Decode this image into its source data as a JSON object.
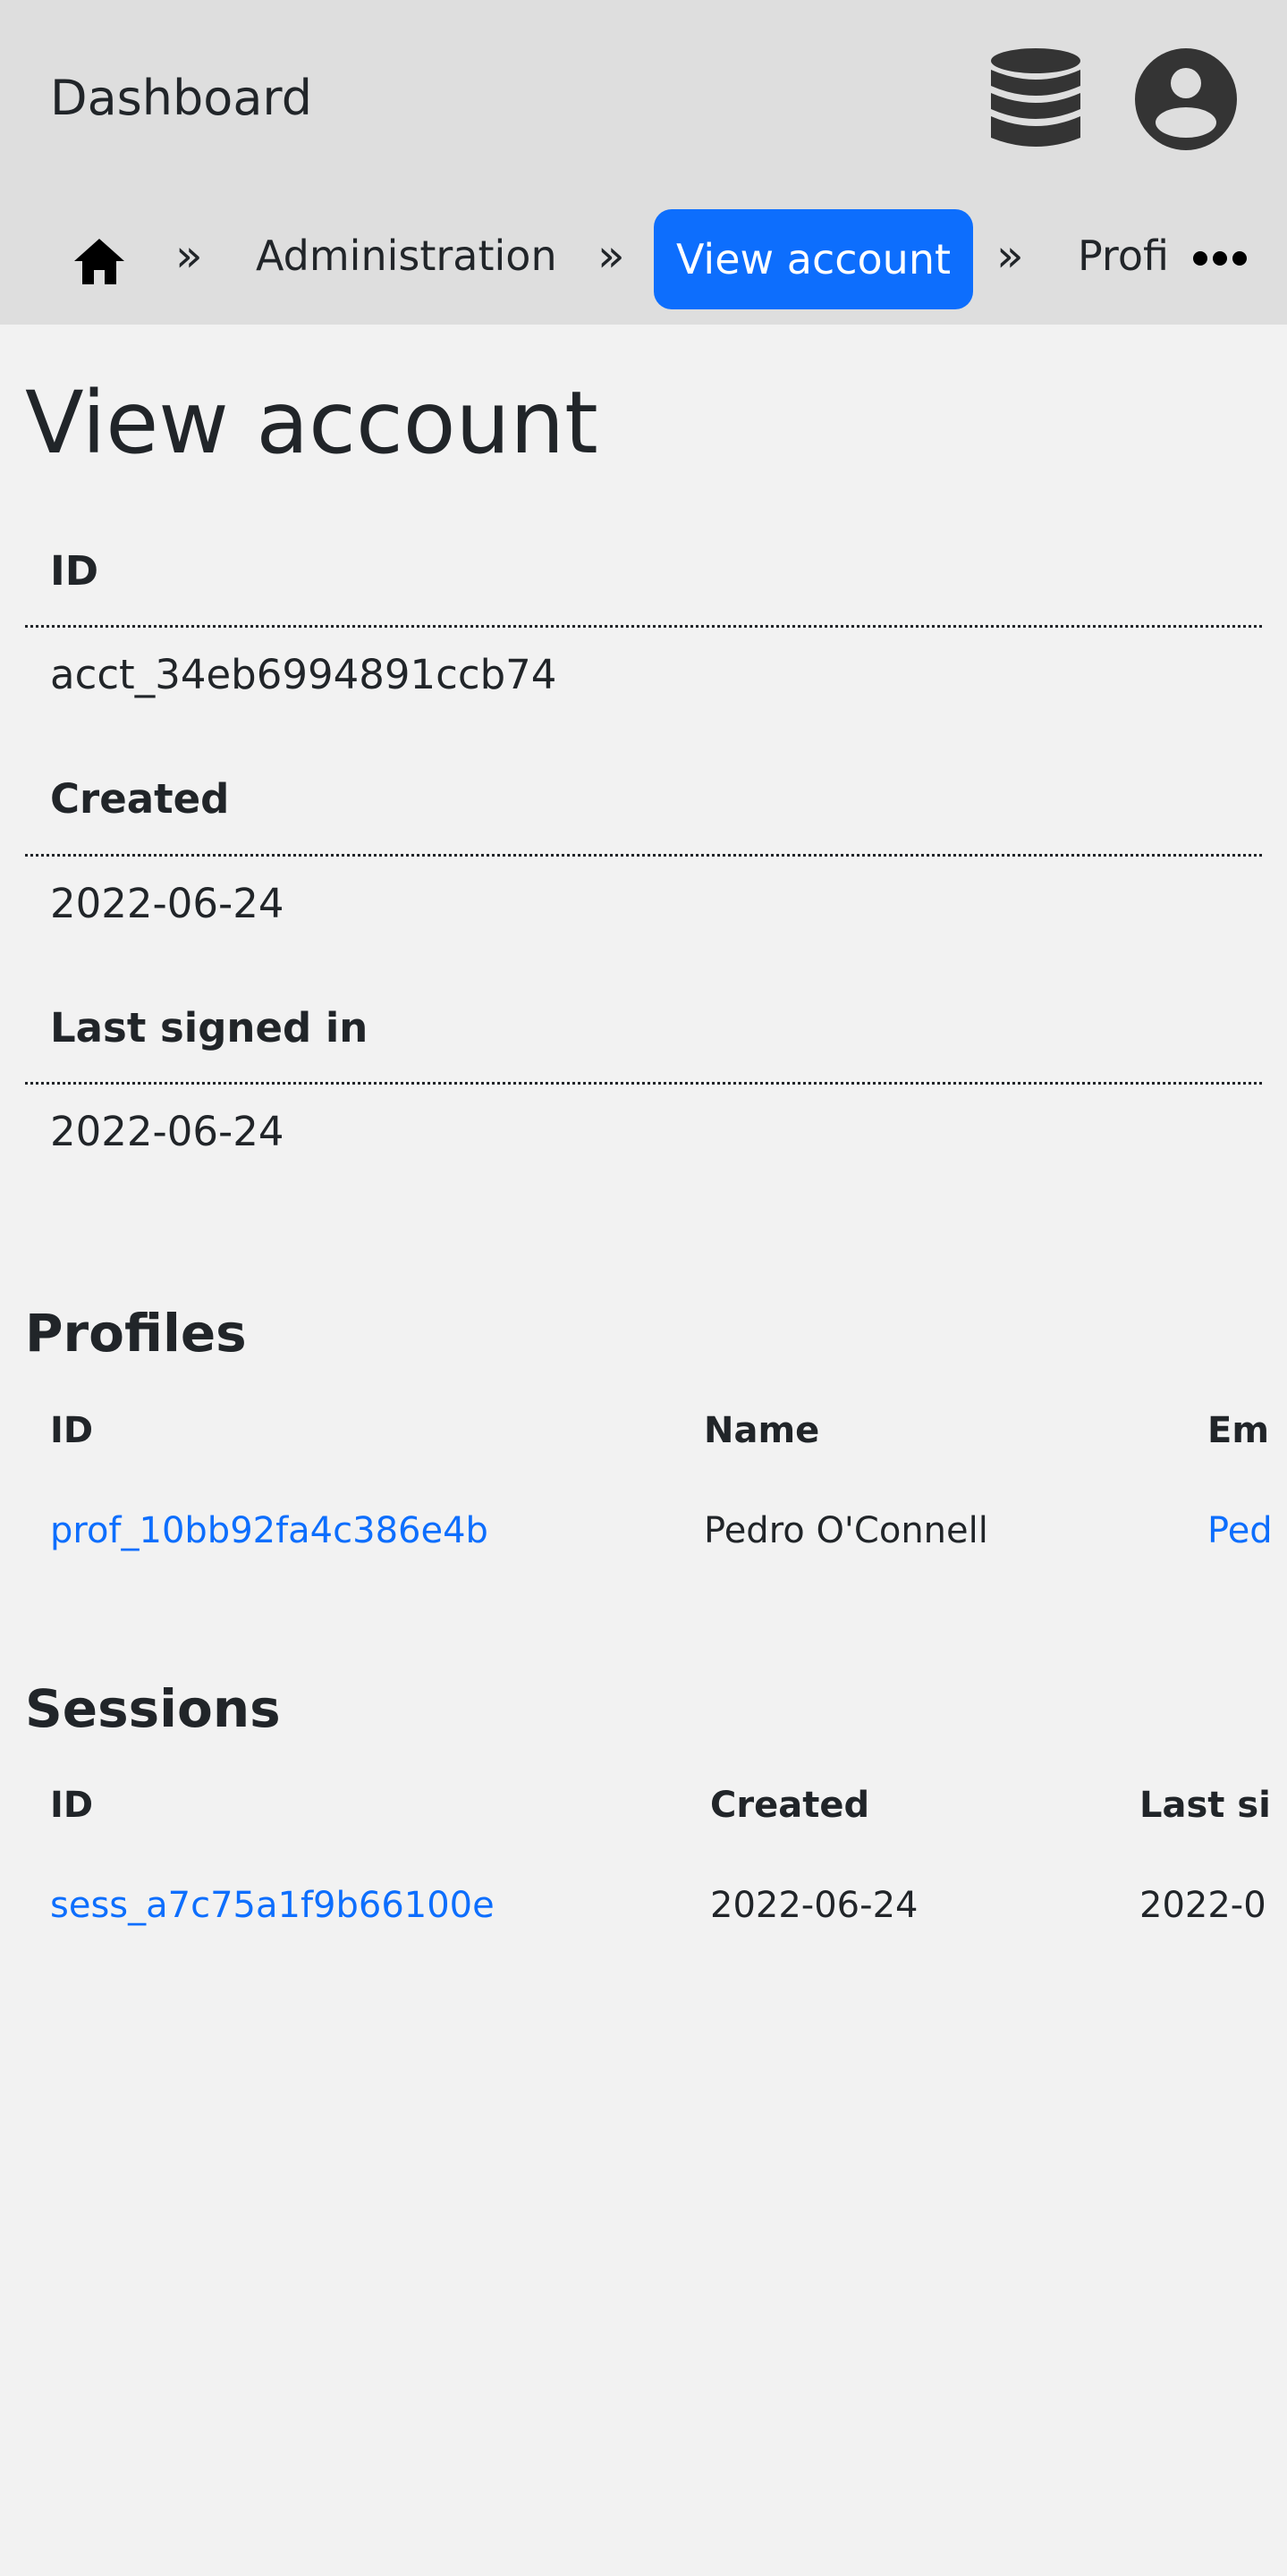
{
  "header": {
    "app_title": "Dashboard",
    "icons": [
      "database-icon",
      "account-circle-icon"
    ]
  },
  "breadcrumb": {
    "separator": "»",
    "items": [
      {
        "label": "home",
        "icon": "home-icon"
      },
      {
        "label": "Administration"
      },
      {
        "label": "View account",
        "active": true
      },
      {
        "label": "Profi"
      }
    ],
    "more_icon": "more-horizontal-icon"
  },
  "page": {
    "title": "View account"
  },
  "details": [
    {
      "label": "ID",
      "value": "acct_34eb6994891ccb74"
    },
    {
      "label": "Created",
      "value": "2022-06-24"
    },
    {
      "label": "Last signed in",
      "value": "2022-06-24"
    }
  ],
  "profiles": {
    "title": "Profiles",
    "columns": [
      "ID",
      "Name",
      "Em"
    ],
    "rows": [
      {
        "id": "prof_10bb92fa4c386e4b",
        "name": "Pedro O'Connell",
        "email": "Ped"
      }
    ]
  },
  "sessions": {
    "title": "Sessions",
    "columns": [
      "ID",
      "Created",
      "Last si"
    ],
    "rows": [
      {
        "id": "sess_a7c75a1f9b66100e",
        "created": "2022-06-24",
        "last_signed_in": "2022-0"
      }
    ]
  },
  "colors": {
    "header_bg": "#dedede",
    "page_bg": "#f2f2f2",
    "accent": "#0d6efd",
    "text": "#212529"
  }
}
